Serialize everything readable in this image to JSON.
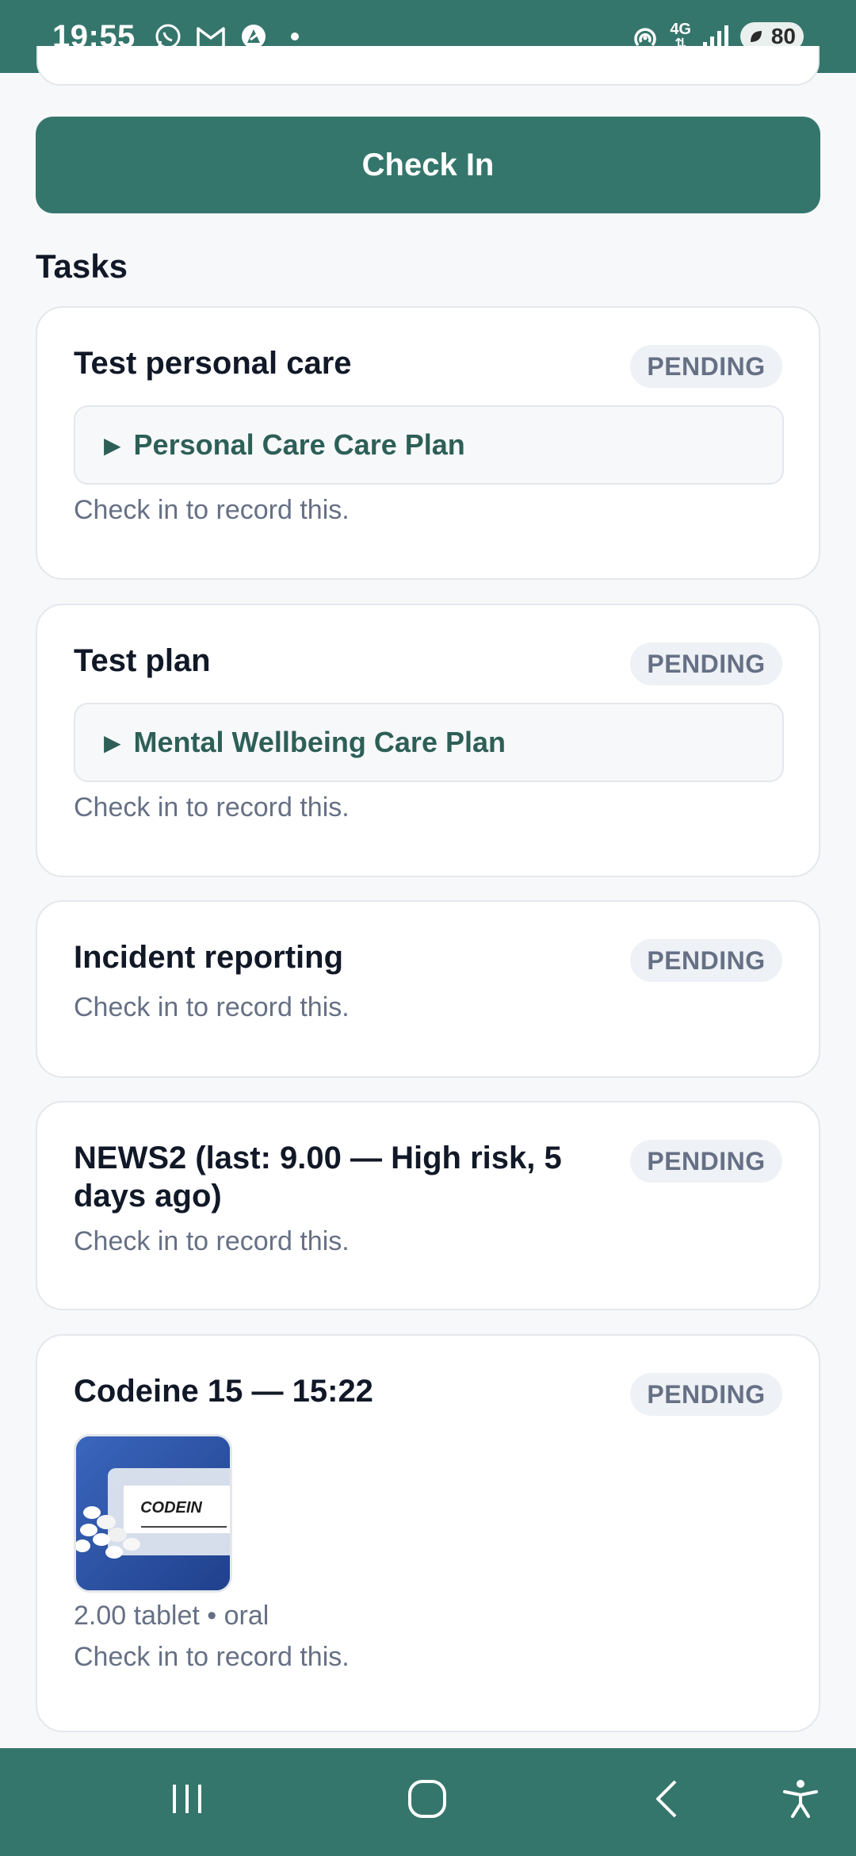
{
  "status_bar": {
    "time": "19:55",
    "network": "4G",
    "battery": "80",
    "icons": [
      "whatsapp-icon",
      "gmail-icon",
      "app-notification-icon",
      "hotspot-icon",
      "signal-icon",
      "battery-icon"
    ]
  },
  "actions": {
    "check_in_label": "Check In"
  },
  "tasks_section": {
    "title": "Tasks",
    "items": [
      {
        "title": "Test personal care",
        "status": "PENDING",
        "plan_label": "Personal Care Care Plan",
        "hint": "Check in to record this."
      },
      {
        "title": "Test plan",
        "status": "PENDING",
        "plan_label": "Mental Wellbeing Care Plan",
        "hint": "Check in to record this."
      },
      {
        "title": "Incident reporting",
        "status": "PENDING",
        "hint": "Check in to record this."
      },
      {
        "title_line1": "NEWS2 (last: 9.00 — High risk, 5",
        "title_line2": "days ago)",
        "status": "PENDING",
        "hint": "Check in to record this."
      },
      {
        "title": "Codeine 15 — 15:22",
        "status": "PENDING",
        "image_label": "CODEIN",
        "dose": "2.00 tablet • oral",
        "hint": "Check in to record this."
      }
    ]
  },
  "colors": {
    "primary": "#35766c",
    "plan_text": "#2d5f57",
    "muted": "#667085",
    "badge_bg": "#eef1f5"
  },
  "nav_bar": {
    "icons": [
      "recent-apps-icon",
      "home-icon",
      "back-icon",
      "accessibility-icon"
    ]
  }
}
